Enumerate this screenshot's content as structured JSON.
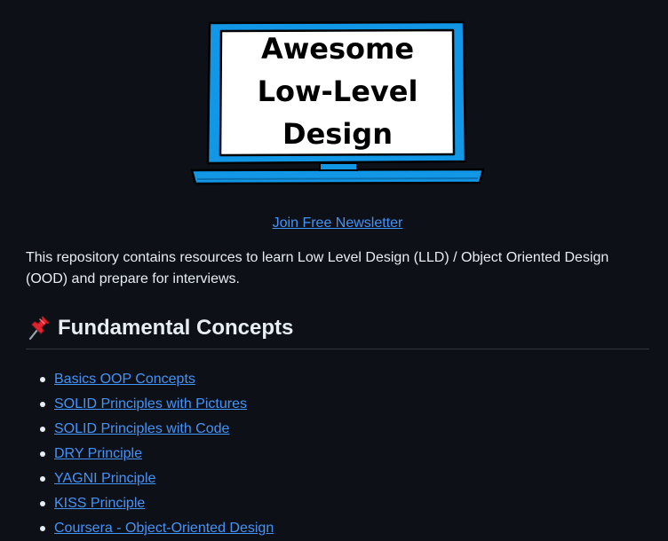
{
  "banner": {
    "logo_name": "awesome-lld-laptop-logo",
    "logo_lines": [
      "Awesome",
      "Low-Level",
      "Design"
    ],
    "colors": {
      "frame": "#1296e6",
      "screen": "#ffffff",
      "outline": "#000000"
    }
  },
  "newsletter": {
    "label": "Join Free Newsletter"
  },
  "intro": {
    "text": "This repository contains resources to learn Low Level Design (LLD) / Object Oriented Design (OOD) and prepare for interviews."
  },
  "section": {
    "icon": "pushpin-icon",
    "title": "Fundamental Concepts"
  },
  "concepts": [
    {
      "label": "Basics OOP Concepts"
    },
    {
      "label": "SOLID Principles with Pictures"
    },
    {
      "label": "SOLID Principles with Code"
    },
    {
      "label": "DRY Principle"
    },
    {
      "label": "YAGNI Principle"
    },
    {
      "label": "KISS Principle"
    },
    {
      "label": "Coursera - Object-Oriented Design"
    }
  ],
  "theme": {
    "background": "#0d1117",
    "text": "#e6edf3",
    "link": "#4493f8",
    "divider": "#30363d"
  }
}
